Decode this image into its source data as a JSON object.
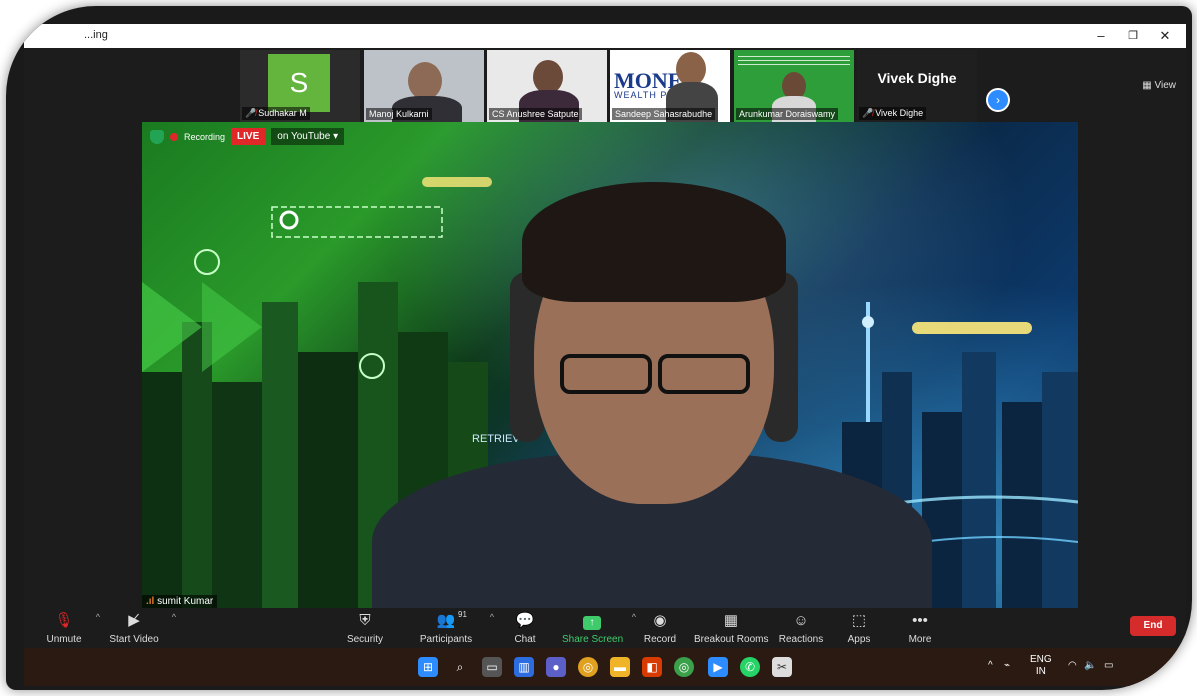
{
  "window": {
    "title": "...ing",
    "minimize": "–",
    "restore": "❐",
    "close": "✕"
  },
  "strip": {
    "participants": [
      {
        "name": "Sudhakar M",
        "muted": true,
        "avatar_letter": "S"
      },
      {
        "name": "Manoj Kulkarni",
        "muted": false
      },
      {
        "name": "CS Anushree Satpute",
        "muted": false
      },
      {
        "name": "Sandeep Sahasrabudhe",
        "muted": false,
        "bg_text": "MONEY",
        "bg_sub": "WEALTH PL  RS"
      },
      {
        "name": "Arunkumar Doraiswamy",
        "muted": false
      },
      {
        "name": "Vivek Dighe",
        "muted": true,
        "display_name": "Vivek Dighe"
      }
    ],
    "next_label": "›",
    "view_label": "View"
  },
  "main": {
    "recording_label": "Recording",
    "live_label": "LIVE",
    "youtube_label": "on YouTube",
    "youtube_caret": "▾",
    "speaker_name": "sumit Kumar",
    "bg_text": "RETRIEV"
  },
  "toolbar": {
    "unmute": "Unmute",
    "start_video": "Start Video",
    "security": "Security",
    "participants": "Participants",
    "participants_count": "91",
    "chat": "Chat",
    "share_screen": "Share Screen",
    "record": "Record",
    "breakout_rooms": "Breakout Rooms",
    "reactions": "Reactions",
    "apps": "Apps",
    "more": "More",
    "end": "End"
  },
  "taskbar": {
    "lang_top": "ENG",
    "lang_bottom": "IN"
  },
  "colors": {
    "live_red": "#e02828",
    "accent_blue": "#2d8cff",
    "share_green": "#3fcb6b",
    "end_red": "#d52b2b"
  }
}
